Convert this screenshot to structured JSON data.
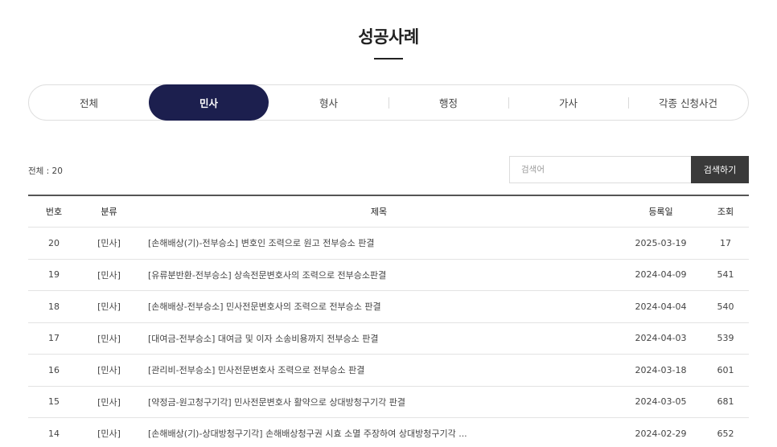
{
  "page": {
    "title": "성공사례"
  },
  "tabs": [
    {
      "label": "전체"
    },
    {
      "label": "민사",
      "active": true
    },
    {
      "label": "형사"
    },
    {
      "label": "행정"
    },
    {
      "label": "가사"
    },
    {
      "label": "각종 신청사건"
    }
  ],
  "toolbar": {
    "total": "전체 : 20",
    "search_placeholder": "검색어",
    "search_button": "검색하기"
  },
  "table": {
    "headers": {
      "num": "번호",
      "category": "분류",
      "title": "제목",
      "date": "등록일",
      "views": "조회"
    },
    "rows": [
      {
        "num": "20",
        "category": "[민사]",
        "title": "[손해배상(기)-전부승소] 변호인 조력으로 원고 전부승소 판결",
        "date": "2025-03-19",
        "views": "17"
      },
      {
        "num": "19",
        "category": "[민사]",
        "title": "[유류분반환-전부승소] 상속전문변호사의 조력으로 전부승소판결",
        "date": "2024-04-09",
        "views": "541"
      },
      {
        "num": "18",
        "category": "[민사]",
        "title": "[손해배상-전부승소] 민사전문변호사의 조력으로 전부승소 판결",
        "date": "2024-04-04",
        "views": "540"
      },
      {
        "num": "17",
        "category": "[민사]",
        "title": "[대여금-전부승소] 대여금 및 이자 소송비용까지 전부승소 판결",
        "date": "2024-04-03",
        "views": "539"
      },
      {
        "num": "16",
        "category": "[민사]",
        "title": "[관리비-전부승소] 민사전문변호사 조력으로 전부승소 판결",
        "date": "2024-03-18",
        "views": "601"
      },
      {
        "num": "15",
        "category": "[민사]",
        "title": "[약정금-원고청구기각] 민사전문변호사 활약으로 상대방청구기각 판결",
        "date": "2024-03-05",
        "views": "681"
      },
      {
        "num": "14",
        "category": "[민사]",
        "title": "[손해배상(기)-상대방청구기각] 손해배상청구권 시효 소멸 주장하여 상대방청구기각 ...",
        "date": "2024-02-29",
        "views": "652"
      }
    ]
  }
}
